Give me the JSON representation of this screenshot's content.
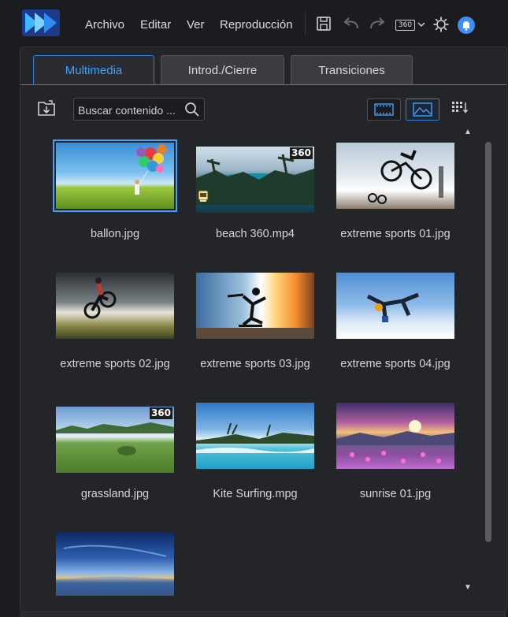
{
  "menu": {
    "items": [
      "Archivo",
      "Editar",
      "Ver",
      "Reproducción"
    ]
  },
  "toolbar": {
    "badge_360": "360"
  },
  "tabs": [
    {
      "label": "Multimedia"
    },
    {
      "label": "Introd./Cierre"
    },
    {
      "label": "Transiciones"
    }
  ],
  "search": {
    "placeholder": "Buscar contenido ..."
  },
  "media": [
    {
      "name": "ballon.jpg",
      "badge": ""
    },
    {
      "name": "beach 360.mp4",
      "badge": "360"
    },
    {
      "name": "extreme sports 01.jpg",
      "badge": ""
    },
    {
      "name": "extreme sports 02.jpg",
      "badge": ""
    },
    {
      "name": "extreme sports 03.jpg",
      "badge": ""
    },
    {
      "name": "extreme sports 04.jpg",
      "badge": ""
    },
    {
      "name": "grassland.jpg",
      "badge": "360"
    },
    {
      "name": "Kite Surfing.mpg",
      "badge": ""
    },
    {
      "name": "sunrise 01.jpg",
      "badge": ""
    },
    {
      "name": "",
      "badge": ""
    }
  ],
  "colors": {
    "accent": "#3aa3ff",
    "background": "#1b1c1f",
    "panel": "#242529"
  },
  "icons": {
    "logo": "app-logo",
    "save": "save-icon",
    "undo": "undo-icon",
    "redo": "redo-icon",
    "view360": "360-view-icon",
    "settings": "gear-icon",
    "notifications": "bell-icon",
    "import": "import-media-icon",
    "search": "search-icon",
    "storyboard": "storyboard-view-icon",
    "thumbnail": "thumbnail-view-icon",
    "sort": "sort-icon"
  }
}
